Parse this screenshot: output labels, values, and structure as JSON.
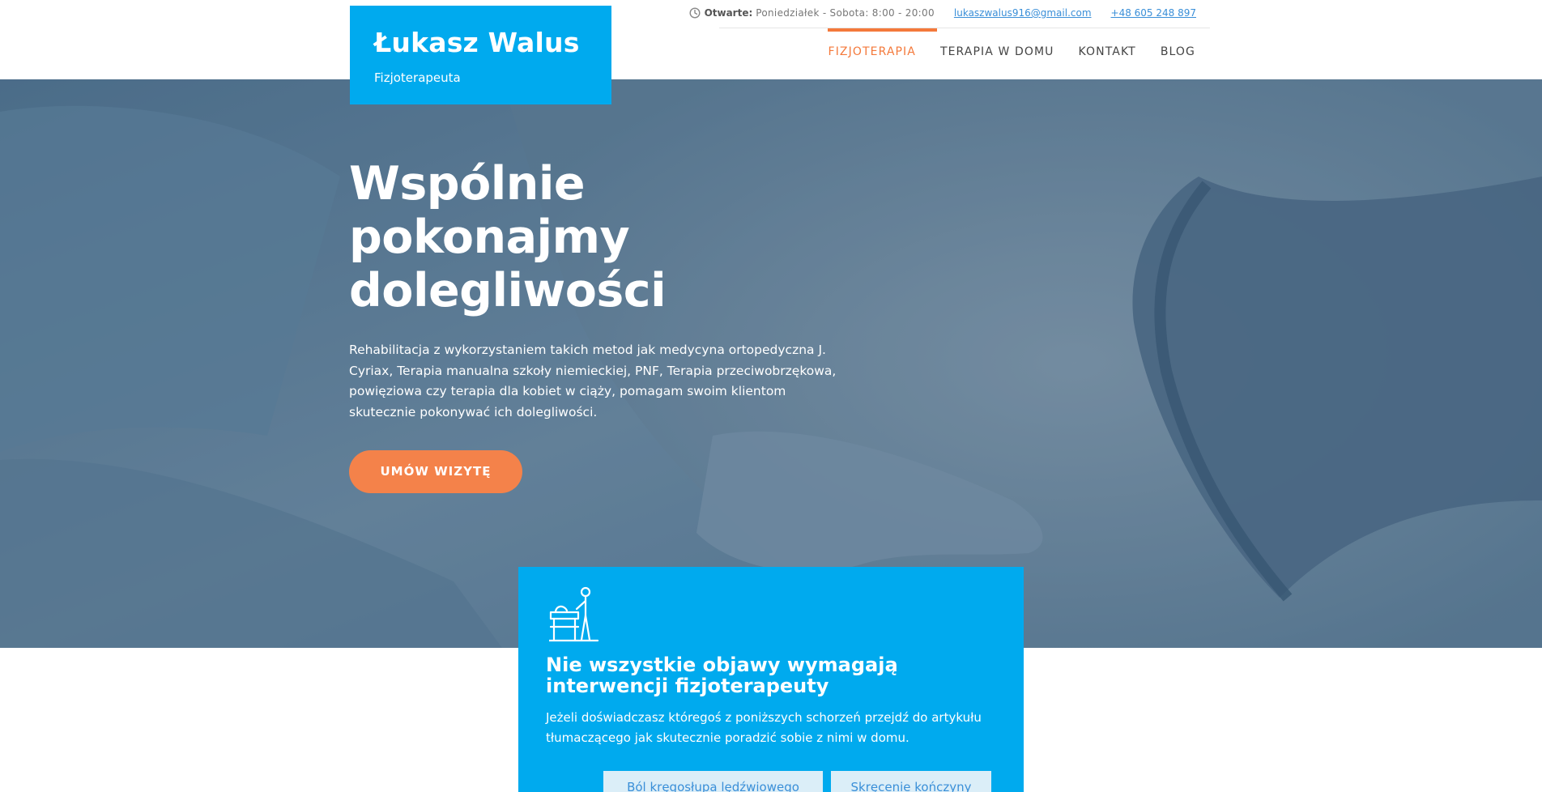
{
  "header": {
    "logo_name": "Łukasz Walus",
    "logo_subtitle": "Fizjoterapeuta",
    "hours_label": "Otwarte:",
    "hours_value": "Poniedziałek - Sobota: 8:00 - 20:00",
    "email": "lukaszwalus916@gmail.com",
    "phone": "+48 605 248 897",
    "nav": [
      {
        "label": "FIZJOTERAPIA",
        "active": true
      },
      {
        "label": "TERAPIA W DOMU",
        "active": false
      },
      {
        "label": "KONTAKT",
        "active": false
      },
      {
        "label": "BLOG",
        "active": false
      }
    ]
  },
  "hero": {
    "title_lines": [
      "Wspólnie",
      "pokonajmy",
      "dolegliwości"
    ],
    "text": "Rehabilitacja z wykorzystaniem takich metod jak medycyna ortopedyczna J. Cyriax, Terapia manualna szkoły niemieckiej, PNF, Terapia przeciwobrzękowa, powięziowa czy terapia dla kobiet w ciąży, pomagam swoim klientom skutecznie pokonywać ich dolegliwości.",
    "cta_label": "UMÓW WIZYTĘ"
  },
  "card": {
    "icon": "physiotherapy-table-icon",
    "title": "Nie wszystkie objawy wymagają interwencji fizjoterapeuty",
    "text": "Jeżeli doświadczasz któregoś z poniższych schorzeń przejdź do artykułu tłumaczącego jak skutecznie poradzić sobie z nimi w domu.",
    "buttons": [
      "Ból kręgosłupa lędźwiowego",
      "Skręcenie kończyny"
    ]
  },
  "colors": {
    "brand_blue": "#00aaee",
    "accent_orange": "#f4793b",
    "link_blue": "#3a8fd8"
  }
}
